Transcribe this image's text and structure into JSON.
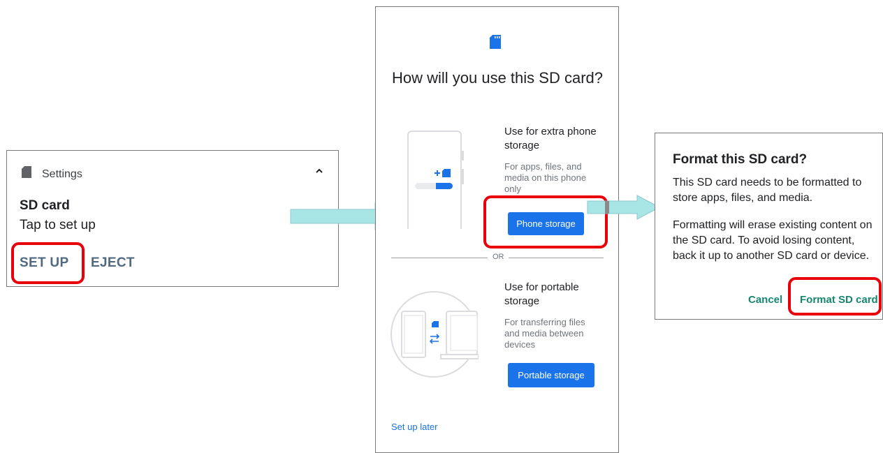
{
  "notification": {
    "app_name": "Settings",
    "title": "SD card",
    "subtitle": "Tap to set up",
    "actions": {
      "setup": "SET UP",
      "eject": "EJECT"
    }
  },
  "setup_screen": {
    "heading": "How will you use this SD card?",
    "phone_option": {
      "title": "Use for extra phone storage",
      "description": "For apps, files, and media on this phone only",
      "button": "Phone storage"
    },
    "divider": "OR",
    "portable_option": {
      "title": "Use for portable storage",
      "description": "For transferring files and media between devices",
      "button": "Portable storage"
    },
    "later_link": "Set up later"
  },
  "format_dialog": {
    "title": "Format this SD card?",
    "body_1": "This SD card needs to be formatted to store apps, files, and media.",
    "body_2": "Formatting will erase existing content on the SD card. To avoid losing content, back it up to another SD card or device.",
    "cancel": "Cancel",
    "confirm": "Format SD card"
  },
  "colors": {
    "accent_blue": "#1a73e8",
    "dialog_button_teal": "#16866f",
    "highlight_red": "#e8000b",
    "arrow_cyan": "#a8e6e6",
    "notification_action": "#516a80"
  },
  "icons": [
    "sd-card-icon",
    "chevron-up-icon",
    "flow-arrow",
    "phone-illustration",
    "devices-illustration"
  ]
}
